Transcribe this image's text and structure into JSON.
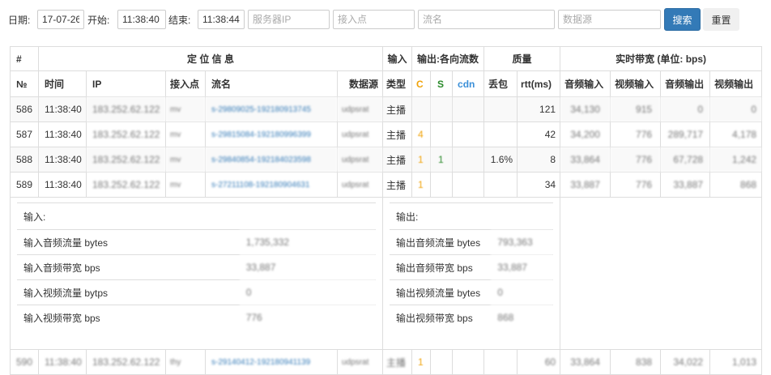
{
  "filter": {
    "date_label": "日期:",
    "date": "17-07-26",
    "start_label": "开始:",
    "start": "11:38:40",
    "end_label": "结束:",
    "end": "11:38:44",
    "ip_ph": "服务器IP",
    "ap_ph": "接入点",
    "stream_ph": "流名",
    "src_ph": "数据源",
    "search": "搜索",
    "reset": "重置"
  },
  "header1": {
    "hash": "#",
    "loc": "定 位 信 息",
    "input": "输入",
    "output": "输出:各向流数",
    "quality": "质量",
    "bw": "实时带宽 (单位: bps)"
  },
  "header2": {
    "no": "№",
    "time": "时间",
    "ip": "IP",
    "ap": "接入点",
    "stream": "流名",
    "src": "数据源",
    "type": "类型",
    "c": "C",
    "s": "S",
    "cdn": "cdn",
    "loss": "丢包",
    "rtt": "rtt(ms)",
    "ai": "音频输入",
    "vi": "视频输入",
    "ao": "音频输出",
    "vo": "视频输出"
  },
  "rows": [
    {
      "no": "586",
      "time": "11:38:40",
      "ip": "183.252.62.122",
      "ap": "mv",
      "stream": "s-29809025-192180913745",
      "src": "udpsrat",
      "type": "主播",
      "c": "",
      "s": "",
      "cdn": "",
      "loss": "",
      "rtt": "121",
      "ai": "34,130",
      "vi": "915",
      "ao": "0",
      "vo": "0"
    },
    {
      "no": "587",
      "time": "11:38:40",
      "ip": "183.252.62.122",
      "ap": "mv",
      "stream": "s-29815084-192180996399",
      "src": "udpsrat",
      "type": "主播",
      "c": "4",
      "s": "",
      "cdn": "",
      "loss": "",
      "rtt": "42",
      "ai": "34,200",
      "vi": "776",
      "ao": "289,717",
      "vo": "4,178"
    },
    {
      "no": "588",
      "time": "11:38:40",
      "ip": "183.252.62.122",
      "ap": "mv",
      "stream": "s-29840854-192184023598",
      "src": "udpsrat",
      "type": "主播",
      "c": "1",
      "s": "1",
      "cdn": "",
      "loss": "1.6%",
      "rtt": "8",
      "ai": "33,864",
      "vi": "776",
      "ao": "67,728",
      "vo": "1,242"
    },
    {
      "no": "589",
      "time": "11:38:40",
      "ip": "183.252.62.122",
      "ap": "mv",
      "stream": "s-27211108-192180904631",
      "src": "udpsrat",
      "type": "主播",
      "c": "1",
      "s": "",
      "cdn": "",
      "loss": "",
      "rtt": "34",
      "ai": "33,887",
      "vi": "776",
      "ao": "33,887",
      "vo": "868"
    }
  ],
  "detail": {
    "input": {
      "title": "输入:",
      "items": [
        {
          "k": "输入音频流量 bytes",
          "v": "1,735,332"
        },
        {
          "k": "输入音频带宽 bps",
          "v": "33,887"
        },
        {
          "k": "输入视频流量 bytps",
          "v": "0"
        },
        {
          "k": "输入视频带宽 bps",
          "v": "776"
        }
      ]
    },
    "output": {
      "title": "输出:",
      "items": [
        {
          "k": "输出音频流量 bytes",
          "v": "793,363"
        },
        {
          "k": "输出音频带宽 bps",
          "v": "33,887"
        },
        {
          "k": "输出视频流量 bytes",
          "v": "0"
        },
        {
          "k": "输出视频带宽 bps",
          "v": "868"
        }
      ]
    }
  },
  "last_row": {
    "no": "590",
    "time": "11:38:40",
    "ip": "183.252.62.122",
    "ap": "thy",
    "stream": "s-29140412-192180941139",
    "src": "udpsrat",
    "type": "主播",
    "c": "1",
    "rtt": "60",
    "ai": "33,864",
    "vi": "838",
    "ao": "34,022",
    "vo": "1,013"
  },
  "colors": {
    "accent": "#337ab7",
    "c": "#f0a30a",
    "s": "#2a8a2a",
    "cdn": "#3a8fd8"
  }
}
